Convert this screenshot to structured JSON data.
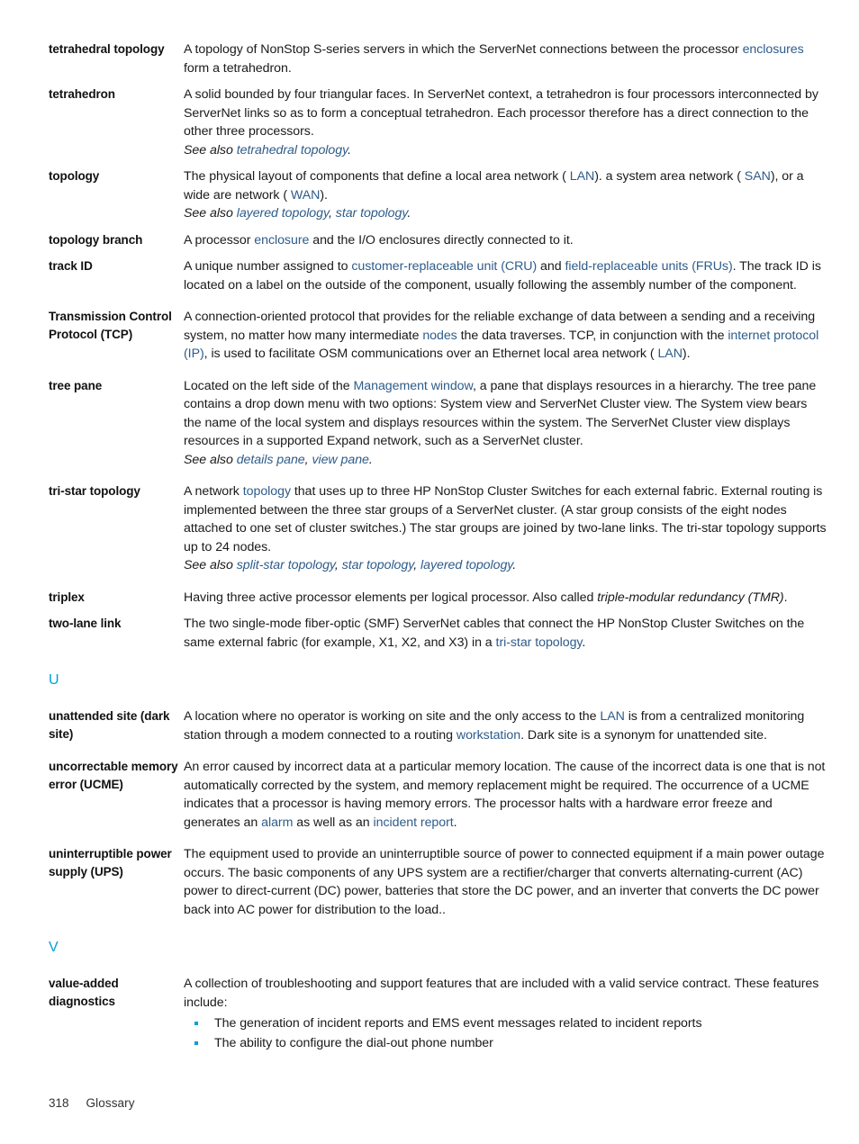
{
  "document": {
    "type": "glossary-page",
    "link_color": "#2e5c8a",
    "section_letter_color": "#00a0d6",
    "bullet_color": "#00a0d6",
    "text_color": "#1a1a1a"
  },
  "entries": [
    {
      "term": "tetrahedral topology",
      "definition": "A topology of NonStop S-series servers in which the ServerNet connections between the processor enclosures form a tetrahedron."
    },
    {
      "term": "tetrahedron",
      "definition": "A solid bounded by four triangular faces. In ServerNet context, a tetrahedron is four processors interconnected by ServerNet links so as to form a conceptual tetrahedron. Each processor therefore has a direct connection to the other three processors.",
      "see_also": "See also tetrahedral topology."
    },
    {
      "term": "topology",
      "definition": "The physical layout of components that define a local area network ( LAN). a system area network ( SAN), or a wide are network ( WAN).",
      "see_also": "See also layered topology, star topology."
    },
    {
      "term": "topology branch",
      "definition": "A processor enclosure and the I/O enclosures directly connected to it."
    },
    {
      "term": "track ID",
      "definition": "A unique number assigned to customer-replaceable unit (CRU) and field-replaceable units (FRUs). The track ID is located on a label on the outside of the component, usually following the assembly number of the component."
    },
    {
      "term": "Transmission Control Protocol (TCP)",
      "definition": "A connection-oriented protocol that provides for the reliable exchange of data between a sending and a receiving system, no matter how many intermediate nodes the data traverses. TCP, in conjunction with the internet protocol (IP), is used to facilitate OSM communications over an Ethernet local area network ( LAN)."
    },
    {
      "term": "tree pane",
      "definition": "Located on the left side of the Management window, a pane that displays resources in a hierarchy. The tree pane contains a drop down menu with two options: System view and ServerNet Cluster view. The System view bears the name of the local system and displays resources within the system. The ServerNet Cluster view displays resources in a supported Expand network, such as a ServerNet cluster.",
      "see_also": "See also details pane, view pane."
    },
    {
      "term": "tri-star topology",
      "definition": "A network topology that uses up to three HP NonStop Cluster Switches for each external fabric. External routing is implemented between the three star groups of a ServerNet cluster. (A star group consists of the eight nodes attached to one set of cluster switches.) The star groups are joined by two-lane links. The tri-star topology supports up to 24 nodes.",
      "see_also": "See also split-star topology, star topology, layered topology."
    },
    {
      "term": "triplex",
      "definition": "Having three active processor elements per logical processor. Also called triple-modular redundancy (TMR)."
    },
    {
      "term": "two-lane link",
      "definition": "The two single-mode fiber-optic (SMF) ServerNet cables that connect the HP NonStop Cluster Switches on the same external fabric (for example, X1, X2, and X3) in a tri-star topology."
    }
  ],
  "section_u": {
    "letter": "U",
    "entries": [
      {
        "term": "unattended site (dark site)",
        "definition": "A location where no operator is working on site and the only access to the LAN is from a centralized monitoring station through a modem connected to a routing workstation. Dark site is a synonym for unattended site."
      },
      {
        "term": "uncorrectable memory error (UCME)",
        "definition": "An error caused by incorrect data at a particular memory location. The cause of the incorrect data is one that is not automatically corrected by the system, and memory replacement might be required. The occurrence of a UCME indicates that a processor is having memory errors. The processor halts with a hardware error freeze and generates an alarm as well as an incident report."
      },
      {
        "term": "uninterruptible power supply (UPS)",
        "definition": "The equipment used to provide an uninterruptible source of power to connected equipment if a main power outage occurs. The basic components of any UPS system are a rectifier/charger that converts alternating-current (AC) power to direct-current (DC) power, batteries that store the DC power, and an inverter that converts the DC power back into AC power for distribution to the load.."
      }
    ]
  },
  "section_v": {
    "letter": "V",
    "entries": [
      {
        "term": "value-added diagnostics",
        "definition": "A collection of troubleshooting and support features that are included with a valid service contract. These features include:",
        "bullets": [
          "The generation of incident reports and EMS event messages related to incident reports",
          "The ability to configure the dial-out phone number"
        ]
      }
    ]
  },
  "footer": {
    "page_number": "318",
    "chapter": "Glossary"
  }
}
